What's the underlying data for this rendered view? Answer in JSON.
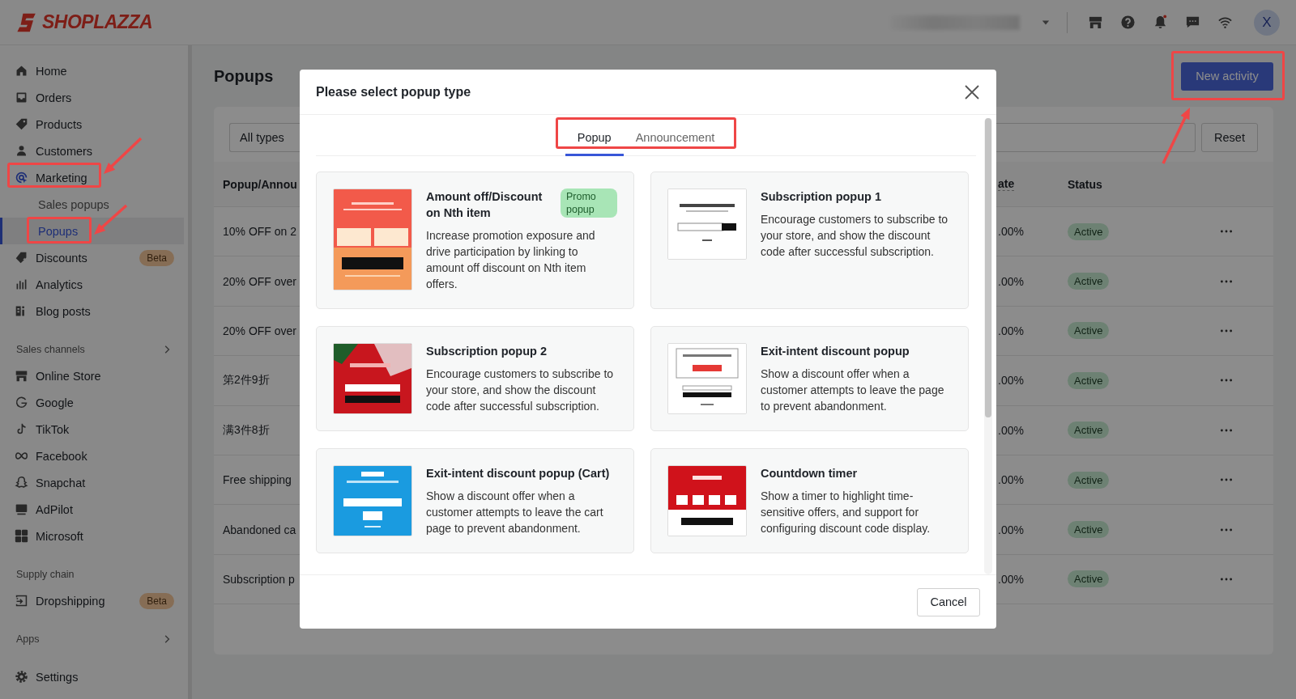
{
  "top_bar": {
    "logo": "SHOPLAZZA",
    "notifications_unread": true,
    "avatar": "X"
  },
  "sidebar": {
    "groups": [
      {
        "items": [
          {
            "label": "Home",
            "selected": false,
            "highlighted": false
          },
          {
            "label": "Orders",
            "selected": false,
            "highlighted": false
          },
          {
            "label": "Products",
            "selected": false,
            "highlighted": false
          },
          {
            "label": "Customers",
            "selected": false,
            "highlighted": false
          },
          {
            "label": "Marketing",
            "selected": false,
            "highlighted": true,
            "expanded": true,
            "children": [
              {
                "label": "Sales popups",
                "selected": false,
                "highlighted": false
              },
              {
                "label": "Popups",
                "selected": true,
                "highlighted": true
              }
            ]
          },
          {
            "label": "Discounts",
            "selected": false,
            "highlighted": false,
            "badge": "Beta"
          },
          {
            "label": "Analytics",
            "selected": false,
            "highlighted": false
          },
          {
            "label": "Blog posts",
            "selected": false,
            "highlighted": false
          }
        ]
      },
      {
        "title": "Sales channels",
        "expandable": true,
        "items": [
          {
            "label": "Online Store",
            "selected": false,
            "highlighted": false
          },
          {
            "label": "Google",
            "selected": false,
            "highlighted": false
          },
          {
            "label": "TikTok",
            "selected": false,
            "highlighted": false
          },
          {
            "label": "Facebook",
            "selected": false,
            "highlighted": false
          },
          {
            "label": "Snapchat",
            "selected": false,
            "highlighted": false
          },
          {
            "label": "AdPilot",
            "selected": false,
            "highlighted": false
          },
          {
            "label": "Microsoft",
            "selected": false,
            "highlighted": false
          }
        ]
      },
      {
        "title": "Supply chain",
        "expandable": false,
        "items": [
          {
            "label": "Dropshipping",
            "selected": false,
            "highlighted": false,
            "badge": "Beta"
          }
        ]
      },
      {
        "title": "Apps",
        "expandable": true
      }
    ],
    "footer_item": {
      "label": "Settings",
      "selected": false,
      "highlighted": false
    }
  },
  "page": {
    "title": "Popups",
    "new_button": {
      "label": "New activity",
      "highlighted": true
    },
    "filters": {
      "type_select": "All types",
      "reset": "Reset"
    },
    "table": {
      "columns": [
        "Popup/Annou",
        "ate",
        "Status"
      ],
      "rows": [
        {
          "column_1": "10% OFF on 2",
          "column_2": ".00%",
          "status": "Active"
        },
        {
          "column_1": "20% OFF over",
          "column_2": ".00%",
          "status": "Active"
        },
        {
          "column_1": "20% OFF over",
          "column_2": ".00%",
          "status": "Active"
        },
        {
          "column_1": "第2件9折",
          "column_2": ".00%",
          "status": "Active"
        },
        {
          "column_1": "满3件8折",
          "column_2": ".00%",
          "status": "Active"
        },
        {
          "column_1": "Free shipping",
          "column_2": ".00%",
          "status": "Active"
        },
        {
          "column_1": "Abandoned ca",
          "column_2": ".00%",
          "status": "Active"
        },
        {
          "column_1": "Subscription p",
          "column_2": ".00%",
          "status": "Active"
        }
      ]
    }
  },
  "modal": {
    "title": "Please select popup type",
    "tabs_highlighted": true,
    "tabs": [
      {
        "label": "Popup",
        "selected": true
      },
      {
        "label": "Announcement",
        "selected": false
      }
    ],
    "cards": [
      {
        "kind": "picture",
        "title": "Amount off/Discount on Nth item",
        "badge": "Promo popup",
        "description": "Increase promotion exposure and drive participation by linking to amount off discount on Nth item offers."
      },
      {
        "kind": "picture",
        "title": "Subscription popup 1",
        "description": "Encourage customers to subscribe to your store, and show the discount code after successful subscription."
      },
      {
        "kind": "picture",
        "title": "Subscription popup 2",
        "description": "Encourage customers to subscribe to your store, and show the discount code after successful subscription."
      },
      {
        "kind": "picture",
        "title": "Exit-intent discount popup",
        "description": "Show a discount offer when a customer attempts to leave the page to prevent abandonment."
      },
      {
        "kind": "picture",
        "title": "Exit-intent discount popup (Cart)",
        "description": "Show a discount offer when a customer attempts to leave the cart page to prevent abandonment."
      },
      {
        "kind": "picture",
        "title": "Countdown timer",
        "description": "Show a timer to highlight time-sensitive offers, and support for configuring discount code display."
      }
    ],
    "cancel": "Cancel"
  }
}
